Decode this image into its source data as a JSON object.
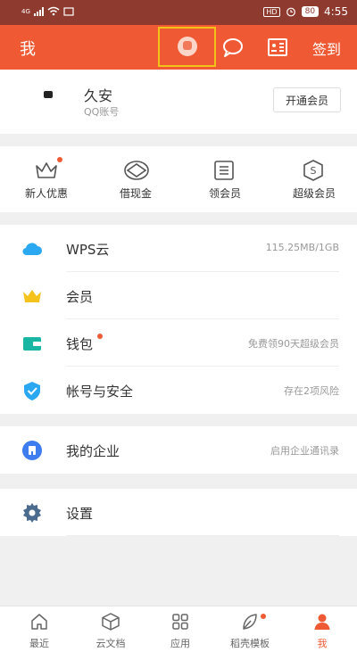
{
  "status_bar": {
    "signal": "4G",
    "hd": "HD",
    "battery": "80",
    "time": "4:55"
  },
  "header": {
    "title": "我",
    "checkin_label": "签到"
  },
  "profile": {
    "name": "久安",
    "account_type": "QQ账号",
    "vip_button": "开通会员"
  },
  "quick_actions": [
    {
      "label": "新人优惠",
      "icon": "crown-outline-icon",
      "has_dot": true
    },
    {
      "label": "借现金",
      "icon": "coin-eye-icon",
      "has_dot": false
    },
    {
      "label": "领会员",
      "icon": "list-card-icon",
      "has_dot": false
    },
    {
      "label": "超级会员",
      "icon": "shield-dollar-icon",
      "has_dot": false
    }
  ],
  "section_one": [
    {
      "label": "WPS云",
      "value": "115.25MB/1GB",
      "icon": "cloud-icon",
      "color": "#2aa8f2"
    },
    {
      "label": "会员",
      "value": "",
      "icon": "crown-icon",
      "color": "#f5c31c"
    },
    {
      "label": "钱包",
      "value": "免费领90天超级会员",
      "icon": "wallet-icon",
      "color": "#19b6a3",
      "has_dot": true
    },
    {
      "label": "帐号与安全",
      "value": "存在2项风险",
      "icon": "shield-check-icon",
      "color": "#2aa8f2"
    }
  ],
  "section_two": [
    {
      "label": "我的企业",
      "value": "启用企业通讯录",
      "icon": "building-icon",
      "color": "#3d7df0"
    }
  ],
  "section_three": [
    {
      "label": "设置",
      "value": "",
      "icon": "gear-icon",
      "color": "#4b6b8f"
    }
  ],
  "tabbar": [
    {
      "label": "最近",
      "icon": "home-icon",
      "active": false
    },
    {
      "label": "云文档",
      "icon": "cube-icon",
      "active": false
    },
    {
      "label": "应用",
      "icon": "apps-grid-icon",
      "active": false
    },
    {
      "label": "稻壳模板",
      "icon": "leaf-icon",
      "active": false,
      "has_dot": true
    },
    {
      "label": "我",
      "icon": "person-icon",
      "active": true
    }
  ],
  "colors": {
    "accent": "#ef5a34",
    "status_bar": "#8f3a2f",
    "highlight_border": "#f3c219"
  }
}
